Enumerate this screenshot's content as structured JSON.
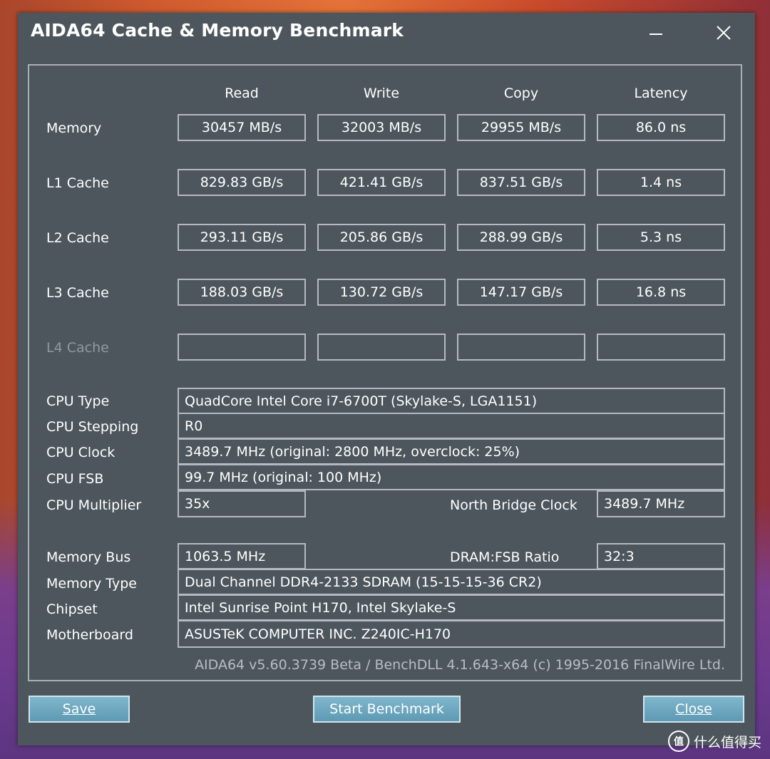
{
  "window": {
    "title": "AIDA64 Cache & Memory Benchmark"
  },
  "columns": [
    "Read",
    "Write",
    "Copy",
    "Latency"
  ],
  "rows": [
    {
      "label": "Memory",
      "read": "30457 MB/s",
      "write": "32003 MB/s",
      "copy": "29955 MB/s",
      "latency": "86.0 ns"
    },
    {
      "label": "L1 Cache",
      "read": "829.83 GB/s",
      "write": "421.41 GB/s",
      "copy": "837.51 GB/s",
      "latency": "1.4 ns"
    },
    {
      "label": "L2 Cache",
      "read": "293.11 GB/s",
      "write": "205.86 GB/s",
      "copy": "288.99 GB/s",
      "latency": "5.3 ns"
    },
    {
      "label": "L3 Cache",
      "read": "188.03 GB/s",
      "write": "130.72 GB/s",
      "copy": "147.17 GB/s",
      "latency": "16.8 ns"
    },
    {
      "label": "L4 Cache",
      "read": "",
      "write": "",
      "copy": "",
      "latency": ""
    }
  ],
  "info": {
    "cpu_type_label": "CPU Type",
    "cpu_type": "QuadCore Intel Core i7-6700T  (Skylake-S, LGA1151)",
    "cpu_stepping_label": "CPU Stepping",
    "cpu_stepping": "R0",
    "cpu_clock_label": "CPU Clock",
    "cpu_clock": "3489.7 MHz  (original: 2800 MHz, overclock: 25%)",
    "cpu_fsb_label": "CPU FSB",
    "cpu_fsb": "99.7 MHz  (original: 100 MHz)",
    "cpu_multiplier_label": "CPU Multiplier",
    "cpu_multiplier": "35x",
    "nb_clock_label": "North Bridge Clock",
    "nb_clock": "3489.7 MHz",
    "memory_bus_label": "Memory Bus",
    "memory_bus": "1063.5 MHz",
    "dram_ratio_label": "DRAM:FSB Ratio",
    "dram_ratio": "32:3",
    "memory_type_label": "Memory Type",
    "memory_type": "Dual Channel DDR4-2133 SDRAM  (15-15-15-36 CR2)",
    "chipset_label": "Chipset",
    "chipset": "Intel Sunrise Point H170, Intel Skylake-S",
    "motherboard_label": "Motherboard",
    "motherboard": "ASUSTeK COMPUTER INC. Z240IC-H170"
  },
  "footer": "AIDA64 v5.60.3739 Beta / BenchDLL 4.1.643-x64  (c) 1995-2016 FinalWire Ltd.",
  "buttons": {
    "save": "Save",
    "start": "Start Benchmark",
    "close": "Close"
  },
  "watermark": {
    "icon_text": "值",
    "text": "什么值得买"
  }
}
